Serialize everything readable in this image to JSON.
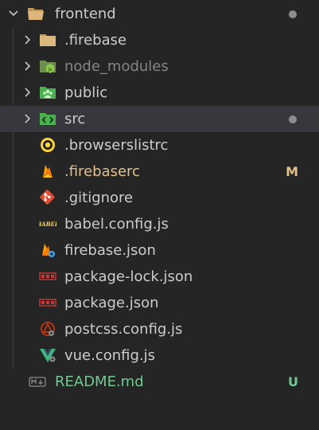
{
  "explorer": {
    "root": {
      "label": "frontend",
      "icon": "folder-open-icon",
      "has_changes": true
    },
    "items": [
      {
        "label": ".firebase",
        "kind": "folder",
        "icon": "folder-icon",
        "color": "#cccccc"
      },
      {
        "label": "node_modules",
        "kind": "folder",
        "icon": "node-folder-icon",
        "color": "#858585"
      },
      {
        "label": "public",
        "kind": "folder",
        "icon": "public-folder-icon",
        "color": "#cccccc"
      },
      {
        "label": "src",
        "kind": "folder",
        "icon": "src-folder-icon",
        "color": "#cccccc",
        "selected": true,
        "has_changes": true
      },
      {
        "label": ".browserslistrc",
        "kind": "file",
        "icon": "browserslist-icon",
        "color": "#cccccc"
      },
      {
        "label": ".firebaserc",
        "kind": "file",
        "icon": "firebase-icon",
        "color": "#e2c08d",
        "status": "M"
      },
      {
        "label": ".gitignore",
        "kind": "file",
        "icon": "git-icon",
        "color": "#cccccc"
      },
      {
        "label": "babel.config.js",
        "kind": "file",
        "icon": "babel-icon",
        "color": "#cccccc"
      },
      {
        "label": "firebase.json",
        "kind": "file",
        "icon": "firebase-config-icon",
        "color": "#cccccc"
      },
      {
        "label": "package-lock.json",
        "kind": "file",
        "icon": "npm-icon",
        "color": "#cccccc"
      },
      {
        "label": "package.json",
        "kind": "file",
        "icon": "npm-icon",
        "color": "#cccccc"
      },
      {
        "label": "postcss.config.js",
        "kind": "file",
        "icon": "postcss-icon",
        "color": "#cccccc"
      },
      {
        "label": "vue.config.js",
        "kind": "file",
        "icon": "vue-icon",
        "color": "#cccccc"
      },
      {
        "label": "README.md",
        "kind": "file",
        "icon": "markdown-icon",
        "color": "#73c991",
        "status": "U"
      }
    ]
  },
  "colors": {
    "background": "#252526",
    "selected_row": "#37373d",
    "modified": "#e2c08d",
    "untracked": "#73c991",
    "ignored": "#858585"
  }
}
